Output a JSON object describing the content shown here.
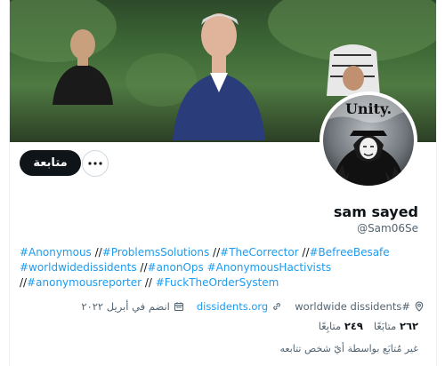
{
  "profile": {
    "display_name": "sam sayed",
    "handle": "@Sam06Se",
    "avatar_text": "Unity.",
    "follow_label": "متابعة",
    "bio_tags": [
      [
        "#Anonymous",
        " //",
        "#ProblemsSolutions",
        " //",
        "#TheCorrector",
        " //",
        "#BefreeBesafe"
      ],
      [
        "#worldwidedissidents",
        " //",
        "#anonOps",
        " ",
        "#AnonymousHactivists"
      ],
      [
        "//",
        "#anonymousreporter",
        " // ",
        "#FuckTheOrderSystem"
      ]
    ],
    "location": "worldwide dissidents#",
    "website": "dissidents.org",
    "joined": "انضم في أبريل ٢٠٢٢",
    "following_count": "٢٦٢",
    "following_label": "متابَعًا",
    "followers_count": "٢٤٩",
    "followers_label": "متابِعًا",
    "followers_note": "غير مُتابَع بواسطة أيّ شخص تتابعه"
  },
  "icons": {
    "more": "more-horizontal-icon",
    "location": "location-pin-icon",
    "link": "link-icon",
    "calendar": "calendar-icon"
  },
  "colors": {
    "accent": "#1d9bf0",
    "follow_button": "#0f1419",
    "secondary_text": "#536471"
  }
}
